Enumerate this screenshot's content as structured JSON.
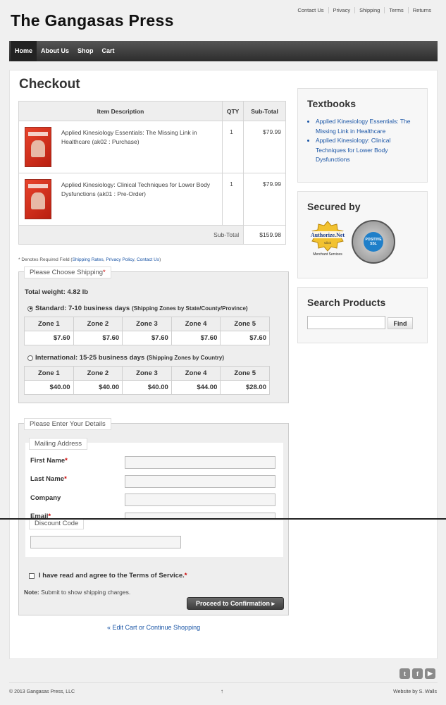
{
  "site": {
    "title": "The Gangasas Press"
  },
  "top_links": [
    "Contact Us",
    "Privacy",
    "Shipping",
    "Terms",
    "Returns"
  ],
  "nav": [
    "Home",
    "About Us",
    "Shop",
    "Cart"
  ],
  "page_title": "Checkout",
  "cart": {
    "headers": {
      "item": "Item Description",
      "qty": "QTY",
      "subtotal": "Sub-Total"
    },
    "items": [
      {
        "description": "Applied Kinesiology Essentials: The Missing Link in Healthcare (ak02 : Purchase)",
        "qty": "1",
        "price": "$79.99"
      },
      {
        "description": "Applied Kinesiology: Clinical Techniques for Lower Body Dysfunctions (ak01 : Pre-Order)",
        "qty": "1",
        "price": "$79.99"
      }
    ],
    "subtotal_label": "Sub-Total",
    "subtotal_value": "$159.98"
  },
  "required_note": {
    "prefix": "* Denotes Required Field (",
    "links": [
      "Shipping Rates",
      "Privacy Policy",
      "Contact Us"
    ],
    "suffix": ")"
  },
  "shipping": {
    "legend": "Please Choose Shipping",
    "total_weight": "Total weight: 4.82 lb",
    "standard": {
      "label": "Standard: 7-10 business days",
      "sub": "(Shipping Zones by State/County/Province)",
      "selected": true
    },
    "international": {
      "label": "International: 15-25 business days",
      "sub": "(Shipping Zones by Country)",
      "selected": false
    },
    "zone_headers": [
      "Zone 1",
      "Zone 2",
      "Zone 3",
      "Zone 4",
      "Zone 5"
    ],
    "standard_rates": [
      "$7.60",
      "$7.60",
      "$7.60",
      "$7.60",
      "$7.60"
    ],
    "international_rates": [
      "$40.00",
      "$40.00",
      "$40.00",
      "$44.00",
      "$28.00"
    ]
  },
  "details": {
    "legend": "Please Enter Your Details",
    "mailing_legend": "Mailing Address",
    "fields": [
      "First Name",
      "Last Name",
      "Company",
      "Email"
    ],
    "required": [
      true,
      true,
      false,
      true
    ],
    "discount_legend": "Discount Code",
    "terms": "I have read and agree to the Terms of Service.",
    "note_bold": "Note:",
    "note_text": "Submit to show shipping charges.",
    "proceed": "Proceed to Confirmation ▸"
  },
  "continue_link": "« Edit Cart or Continue Shopping",
  "sidebar": {
    "textbooks_title": "Textbooks",
    "textbooks": [
      "Applied Kinesiology Essentials: The Missing Link in Healthcare",
      "Applied Kinesiology: Clinical Techniques for Lower Body Dysfunctions"
    ],
    "secured_title": "Secured by",
    "authorize_name": "Authorize.Net",
    "authorize_click": "Click",
    "authorize_sub": "Merchant Services",
    "ssl_text": "POSITIVE SSL",
    "search_title": "Search Products",
    "find": "Find"
  },
  "footer": {
    "copyright": "© 2013 Gangasas Press, LLC",
    "mid": "↑",
    "credit": "Website by S. Walls"
  },
  "colors": {
    "link": "#1a55a6",
    "nav_bg": "#333333",
    "required": "#cc0000"
  }
}
